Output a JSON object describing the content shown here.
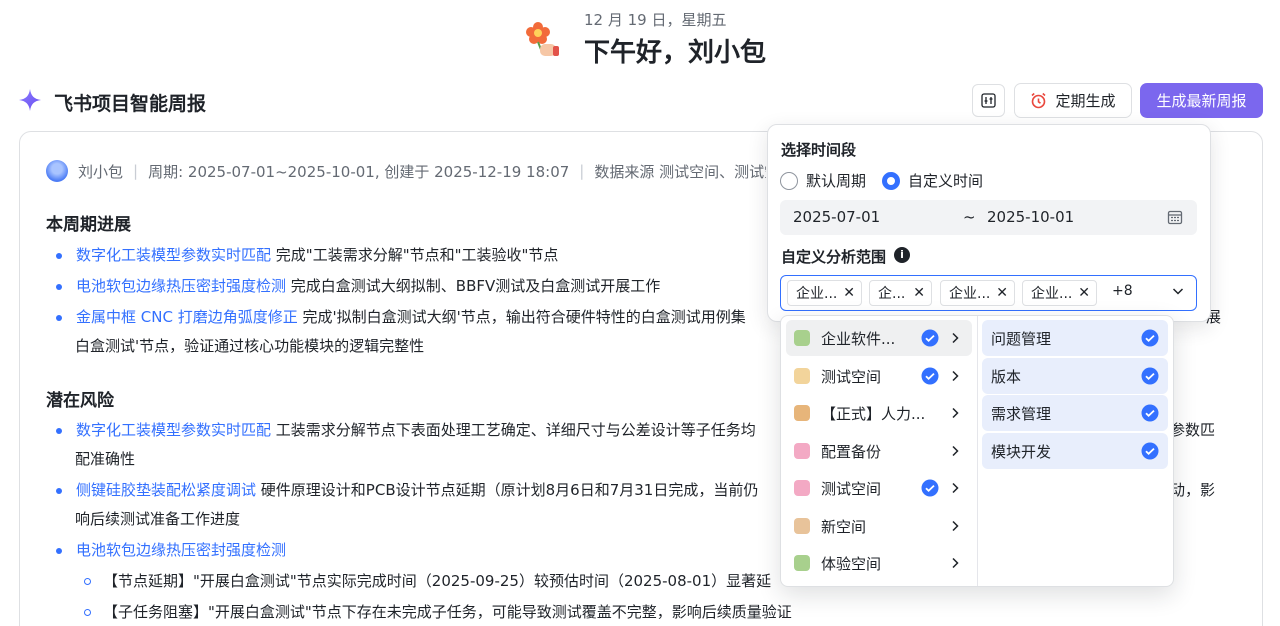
{
  "greeting": {
    "date": "12 月 19 日，星期五",
    "title": "下午好，刘小包"
  },
  "header": {
    "title": "飞书项目智能周报",
    "schedule_btn": "定期生成",
    "generate_btn": "生成最新周报",
    "accent": "#7b67ee"
  },
  "meta": {
    "author": "刘小包",
    "period": "周期: 2025-07-01~2025-10-01, 创建于 2025-12-19 18:07",
    "source": "数据来源 测试空间、测试空"
  },
  "sections": {
    "progress_title": "本周期进展",
    "progress": [
      {
        "link": "数字化工装模型参数实时匹配",
        "text": "完成\"工装需求分解\"节点和\"工装验收\"节点"
      },
      {
        "link": "电池软包边缘热压密封强度检测",
        "text": "完成白盒测试大纲拟制、BBFV测试及白盒测试开展工作"
      },
      {
        "link": "金属中框 CNC 打磨边角弧度修正",
        "text": "完成'拟制白盒测试大纲'节点，输出符合硬件特性的白盒测试用例集",
        "tail": "展",
        "cont": "白盒测试'节点，验证通过核心功能模块的逻辑完整性"
      }
    ],
    "risk_title": "潜在风险",
    "risks": [
      {
        "link": "数字化工装模型参数实时匹配",
        "text": "工装需求分解节点下表面处理工艺确定、详细尺寸与公差设计等子任务均",
        "tail": "参数匹",
        "cont": "配准确性"
      },
      {
        "link": "侧键硅胶垫装配松紧度调试",
        "text": "硬件原理设计和PCB设计节点延期（原计划8月6日和7月31日完成，当前仍",
        "tail": "动，影",
        "cont": "响后续测试准备工作进度"
      },
      {
        "link": "电池软包边缘热压密封强度检测",
        "text": ""
      }
    ],
    "sub_items": [
      "【节点延期】\"开展白盒测试\"节点实际完成时间（2025-09-25）较预估时间（2025-08-01）显著延",
      "【子任务阻塞】\"开展白盒测试\"节点下存在未完成子任务，可能导致测试覆盖不完整，影响后续质量验证"
    ]
  },
  "popover": {
    "period_label": "选择时间段",
    "radio_default": "默认周期",
    "radio_custom": "自定义时间",
    "radio_selected": "custom",
    "date_start": "2025-07-01",
    "date_sep": "~",
    "date_end": "2025-10-01",
    "scope_label": "自定义分析范围",
    "tags": [
      "企业...",
      "企...",
      "企业...",
      "企业..."
    ],
    "more": "+8"
  },
  "dropdown": {
    "spaces": [
      {
        "label": "企业软件...",
        "checked": true,
        "color": "#a8d08d"
      },
      {
        "label": "测试空间",
        "checked": true,
        "color": "#f2d49b"
      },
      {
        "label": "【正式】人力...",
        "checked": false,
        "color": "#e7b57a"
      },
      {
        "label": "配置备份",
        "checked": false,
        "color": "#f3a9c4"
      },
      {
        "label": "测试空间",
        "checked": true,
        "color": "#f3a9c4"
      },
      {
        "label": "新空间",
        "checked": false,
        "color": "#e8c39a"
      },
      {
        "label": "体验空间",
        "checked": false,
        "color": "#a8d08d"
      }
    ],
    "modules": [
      {
        "label": "问题管理",
        "checked": true
      },
      {
        "label": "版本",
        "checked": true
      },
      {
        "label": "需求管理",
        "checked": true
      },
      {
        "label": "模块开发",
        "checked": true
      }
    ],
    "check_color": "#3370ff"
  }
}
